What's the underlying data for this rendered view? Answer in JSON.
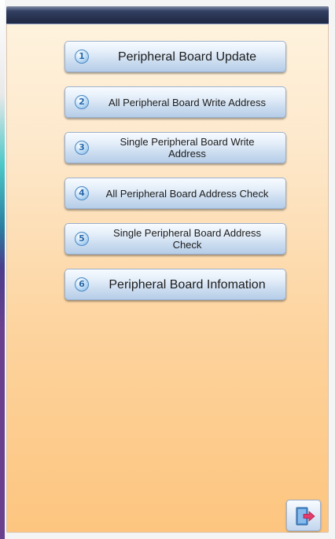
{
  "menu": {
    "items": [
      {
        "number": "1",
        "label": "Peripheral Board Update"
      },
      {
        "number": "2",
        "label": "All Peripheral Board Write Address"
      },
      {
        "number": "3",
        "label": "Single Peripheral Board Write Address"
      },
      {
        "number": "4",
        "label": "All Peripheral Board Address Check"
      },
      {
        "number": "5",
        "label": "Single Peripheral Board Address Check"
      },
      {
        "number": "6",
        "label": "Peripheral Board Infomation"
      }
    ]
  },
  "icons": {
    "exit": "exit-door-icon"
  },
  "colors": {
    "panel_top": "#fff4e0",
    "panel_bottom": "#fdc57f",
    "header": "#2f3b5c",
    "button_top": "#f7fbff",
    "button_bottom": "#b6cde8",
    "number_icon": "#2b69a8",
    "exit_arrow": "#e33b6b"
  }
}
